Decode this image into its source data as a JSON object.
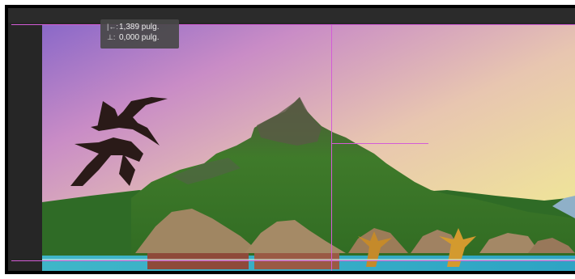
{
  "tooltip": {
    "horizontal": {
      "icon": "horizontal-distance-icon",
      "symbol": "|←:",
      "value": "1,389 pulg."
    },
    "vertical": {
      "icon": "vertical-distance-icon",
      "symbol": "⊥:",
      "value": "0,000 pulg."
    }
  },
  "guides": {
    "color": "#d35cd6"
  },
  "photo": {
    "subject": "tropical-island-mountain-with-birds-and-bungalows"
  }
}
